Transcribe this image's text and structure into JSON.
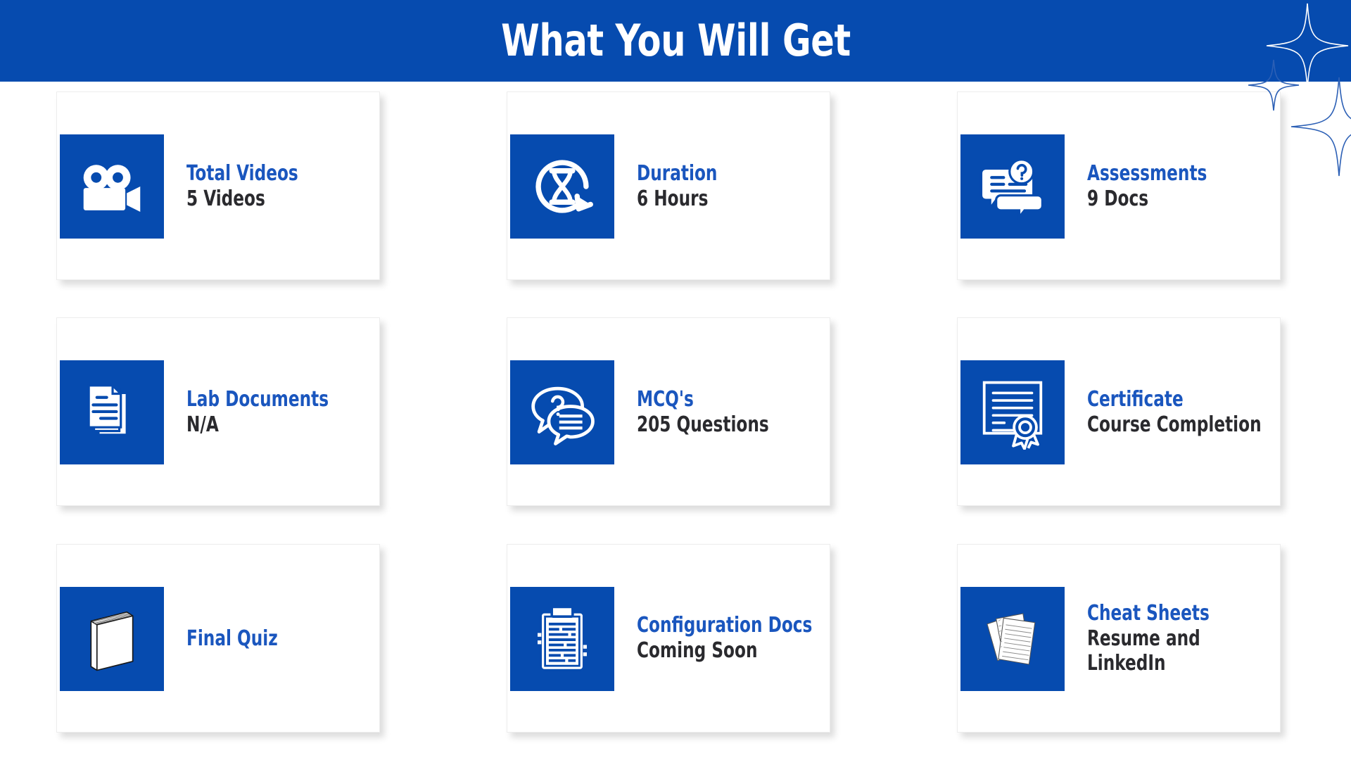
{
  "header": {
    "title": "What You Will Get",
    "background_color": "#064BAF",
    "text_color": "#FFFFFF",
    "decoration": "four-point-sparkles"
  },
  "theme": {
    "accent_blue": "#064BAF",
    "title_blue": "#1A56BE",
    "body_dark": "#2A2A2E",
    "card_bg": "#FFFFFF",
    "page_bg": "#FFFFFF"
  },
  "cards": [
    {
      "icon": "video-camera-icon",
      "title": "Total Videos",
      "subtitle": "5 Videos"
    },
    {
      "icon": "hourglass-clock-icon",
      "title": "Duration",
      "subtitle": "6 Hours"
    },
    {
      "icon": "document-question-icon",
      "title": "Assessments",
      "subtitle": "9 Docs"
    },
    {
      "icon": "stacked-papers-icon",
      "title": "Lab Documents",
      "subtitle": "N/A"
    },
    {
      "icon": "chat-bubbles-icon",
      "title": "MCQ's",
      "subtitle": "205 Questions"
    },
    {
      "icon": "certificate-icon",
      "title": "Certificate",
      "subtitle": "Course Completion"
    },
    {
      "icon": "book-icon",
      "title": "Final Quiz",
      "subtitle": ""
    },
    {
      "icon": "clipboard-icon",
      "title": "Configuration Docs",
      "subtitle": "Coming Soon"
    },
    {
      "icon": "loose-sheets-icon",
      "title": "Cheat Sheets",
      "subtitle": "Resume and\nLinkedIn"
    }
  ]
}
